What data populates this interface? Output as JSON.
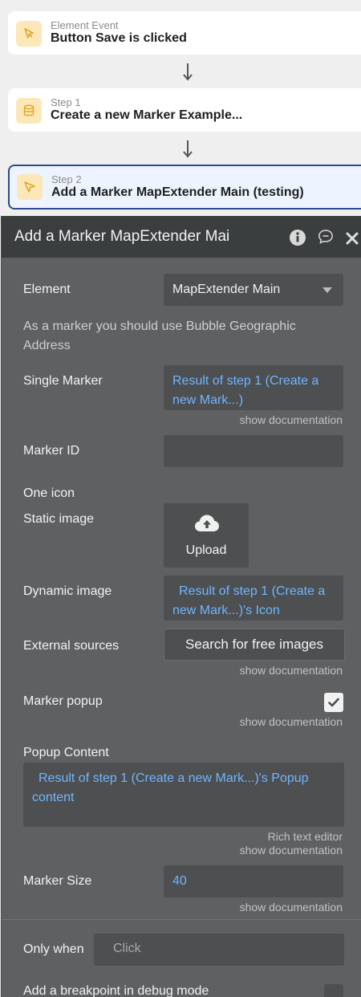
{
  "event": {
    "type_label": "Element Event",
    "title": "Button Save is clicked"
  },
  "step1": {
    "type_label": "Step 1",
    "title": "Create a new Marker Example..."
  },
  "step2": {
    "type_label": "Step 2",
    "title": "Add a Marker MapExtender Main (testing)"
  },
  "panel": {
    "title": "Add a Marker MapExtender Mai",
    "icons": [
      "info-icon",
      "comment-icon",
      "close-icon"
    ],
    "element_label": "Element",
    "element_value": "MapExtender Main",
    "hint": "As a marker you should use Bubble Geographic Address",
    "single_marker_label": "Single Marker",
    "single_marker_value": "Result of step 1 (Create a new Mark...)",
    "show_doc": "show documentation",
    "marker_id_label": "Marker ID",
    "one_icon_label": "One icon",
    "static_image_label": "Static image",
    "upload_label": "Upload",
    "dynamic_image_label": "Dynamic image",
    "dynamic_image_value": "Result of step 1 (Create a new Mark...)'s Icon",
    "external_sources_label": "External sources",
    "search_button": "Search for free images",
    "marker_popup_label": "Marker popup",
    "marker_popup_checked": true,
    "popup_content_label": "Popup Content",
    "popup_content_value": "Result of step 1 (Create a new Mark...)'s Popup content",
    "rich_text": "Rich text editor",
    "marker_size_label": "Marker Size",
    "marker_size_value": "40",
    "only_when_label": "Only when",
    "only_when_placeholder": "Click",
    "breakpoint_label": "Add a breakpoint in debug mode"
  },
  "colors": {
    "link": "#6fb6ff",
    "panel_bg": "#5f6061",
    "header_bg": "#3a3e3f",
    "selected_border": "#2c4a8f",
    "icon_bg": "#fbe7b8",
    "icon_stroke": "#e0a91e"
  }
}
